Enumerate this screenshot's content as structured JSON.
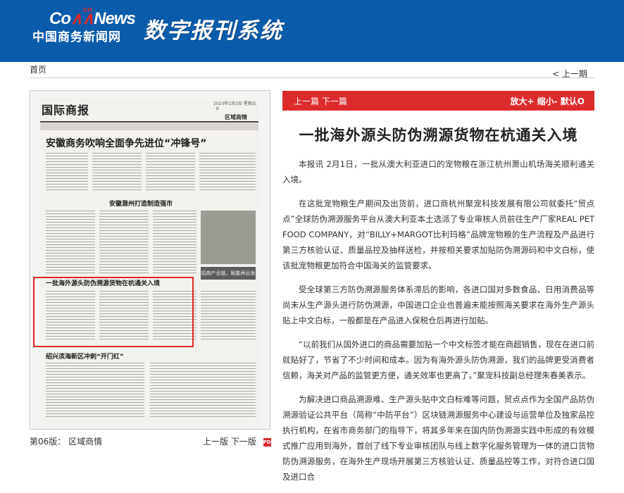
{
  "header": {
    "logo_cn": "cn",
    "logo_com": "Co",
    "logo_news": "News",
    "logo_name": "中国商务新闻网",
    "system_title": "数字报刊系统"
  },
  "nav": {
    "home": "首页",
    "prev_issue": "< 上一期"
  },
  "paper": {
    "masthead": "国际商报",
    "meta": "2023年2月3日 星期五 · 6",
    "section": "区域商情",
    "headline_1": "安徽商务吹响全面争先进位“冲锋号”",
    "headline_2": "安徽滁州打造制造强市",
    "box_text": "招商产业链，赋能再出发",
    "headline_3": "一批海外源头防伪溯源货物在杭通关入境",
    "headline_4": "绍兴滨海新区冲刺“开门红”",
    "page_label": "第06版：",
    "page_name": "区域商情",
    "prev_page": "上一版",
    "next_page": "下一版",
    "pdf": "PDF"
  },
  "toolbar": {
    "prev_article": "上一篇",
    "next_article": "下一篇",
    "zoom_in": "放大+",
    "zoom_out": "缩小-",
    "default": "默认O"
  },
  "article": {
    "title": "一批海外源头防伪溯源货物在杭通关入境",
    "paragraphs": [
      "本报讯 2月1日，一批从澳大利亚进口的宠物粮在浙江杭州萧山机场海关顺利通关入境。",
      "在这批宠物粮生产期间及出货前，进口商杭州聚宠科技发展有限公司就委托“贸点点”全球防伪溯源服务平台从澳大利亚本土选派了专业审核人员前往生产厂家REAL PET FOOD COMPANY，对“BILLY+MARGOT比利玛格”品牌宠物粮的生产流程及产品进行第三方核验认证、质量品控及抽样送检，并按相关要求加贴防伪溯源码和中文白标，使该批宠物粮更加符合中国海关的监管要求。",
      "受全球第三方防伪溯源服务体系滞后的影响，各进口国对多数食品、日用消费品等尚未从生产源头进行防伪溯源，中国进口企业也普遍未能按照海关要求在海外生产源头贴上中文白标，一般都是在产品进入保税仓后再进行加贴。",
      "“以前我们从国外进口的商品需要加贴一个中文标签才能在商超销售，现在在进口前就贴好了，节省了不少时间和成本。因为有海外源头防伪溯源，我们的品牌更受消费者信赖，海关对产品的监管更方便，通关效率也更高了。”聚宠科技副总经理朱春美表示。",
      "为解决进口商品溯源难、生产源头贴中文白标难等问题，贸点点作为全国产品防伪溯源验证公共平台（简称“中防平台”）区块链溯源服务中心建设与运营单位及独家品控执行机构，在省市商务部门的指导下，将其多年来在国内防伪溯源实践中形成的有效模式推广应用到海外，首创了线下专业审核团队与线上数字化服务管理为一体的进口货物防伪溯源服务，在海外生产现场开展第三方核验认证、质量品控等工作，对符合进口国及进口合"
    ]
  },
  "colors": {
    "header_blue": "#0a5cab",
    "accent_red": "#dc2b2b",
    "highlight_red": "#e02727"
  }
}
